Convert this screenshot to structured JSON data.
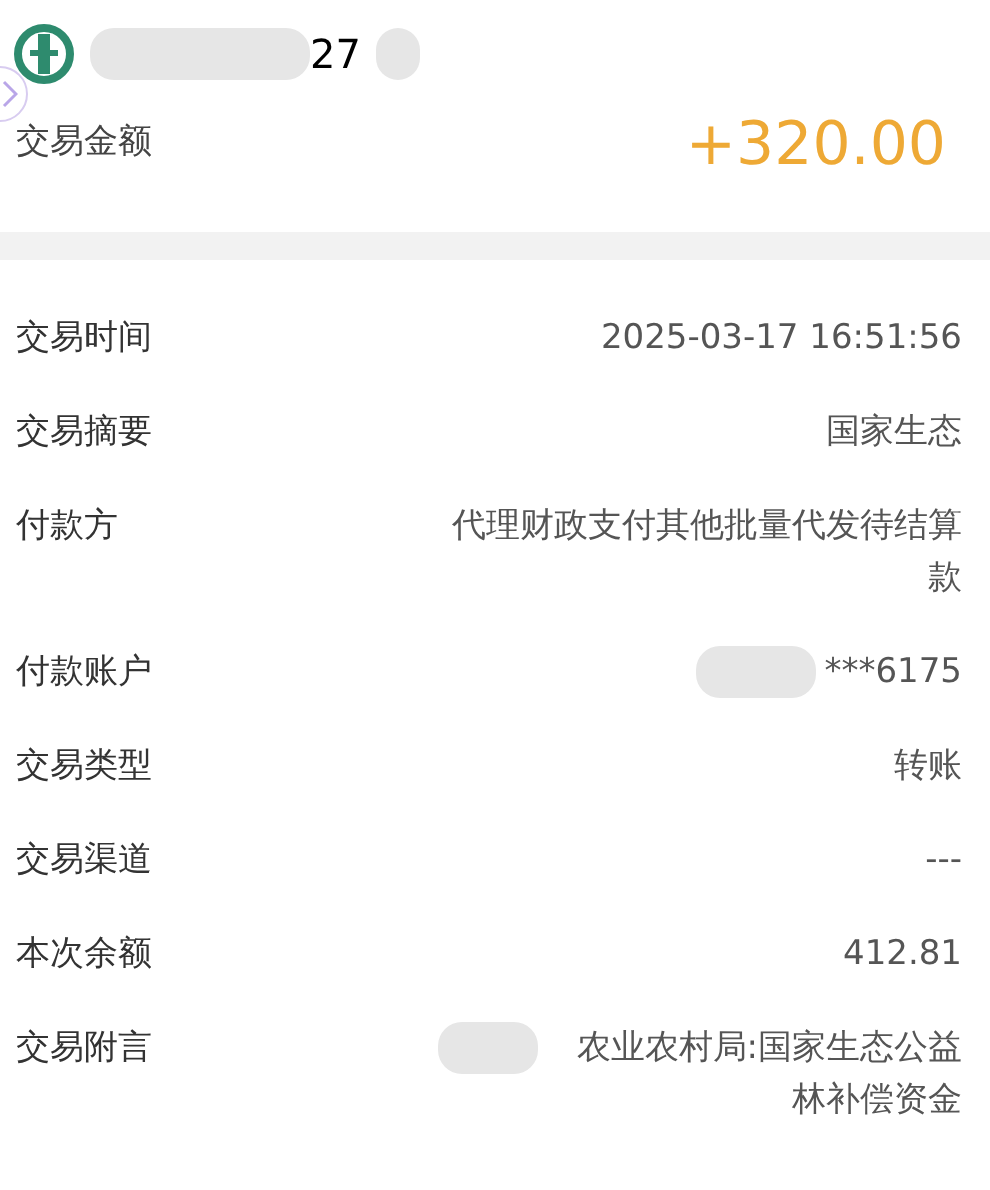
{
  "header": {
    "account_suffix": "27",
    "redacted": true
  },
  "amount": {
    "label": "交易金额",
    "value": "+320.00"
  },
  "details": [
    {
      "label": "交易时间",
      "value": "2025-03-17 16:51:56",
      "redacted": false
    },
    {
      "label": "交易摘要",
      "value": "国家生态",
      "redacted": false
    },
    {
      "label": "付款方",
      "value": "代理财政支付其他批量代发待结算款",
      "redacted": false
    },
    {
      "label": "付款账户",
      "value": "***6175",
      "redacted": true
    },
    {
      "label": "交易类型",
      "value": "转账",
      "redacted": false
    },
    {
      "label": "交易渠道",
      "value": "---",
      "redacted": false
    },
    {
      "label": "本次余额",
      "value": "412.81",
      "redacted": false
    },
    {
      "label": "交易附言",
      "value": "农业农村局:国家生态公益林补偿资金",
      "redacted": true
    }
  ]
}
